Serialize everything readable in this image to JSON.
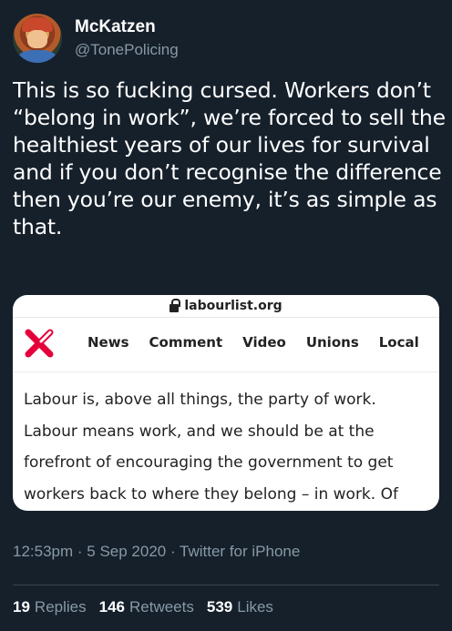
{
  "user": {
    "display_name": "McKatzen",
    "handle": "@TonePolicing"
  },
  "tweet": {
    "text": "This is so fucking cursed. Workers don’t “belong in work”, we’re forced to sell the healthiest years of our lives for survival and if you don’t recognise the difference then you’re our enemy, it’s as simple as that."
  },
  "card": {
    "url": "labourlist.org",
    "nav": [
      "News",
      "Comment",
      "Video",
      "Unions",
      "Local"
    ],
    "article_text": "Labour is, above all things, the party of work. Labour means work, and we should be at the forefront of encouraging the government to get workers back to where they belong – in work. Of course, it is important",
    "logo_color": "#e4003b"
  },
  "meta": {
    "timestamp": "12:53pm · 5 Sep 2020 · Twitter for iPhone"
  },
  "stats": {
    "replies_count": "19",
    "replies_label": "Replies",
    "retweets_count": "146",
    "retweets_label": "Retweets",
    "likes_count": "539",
    "likes_label": "Likes"
  }
}
